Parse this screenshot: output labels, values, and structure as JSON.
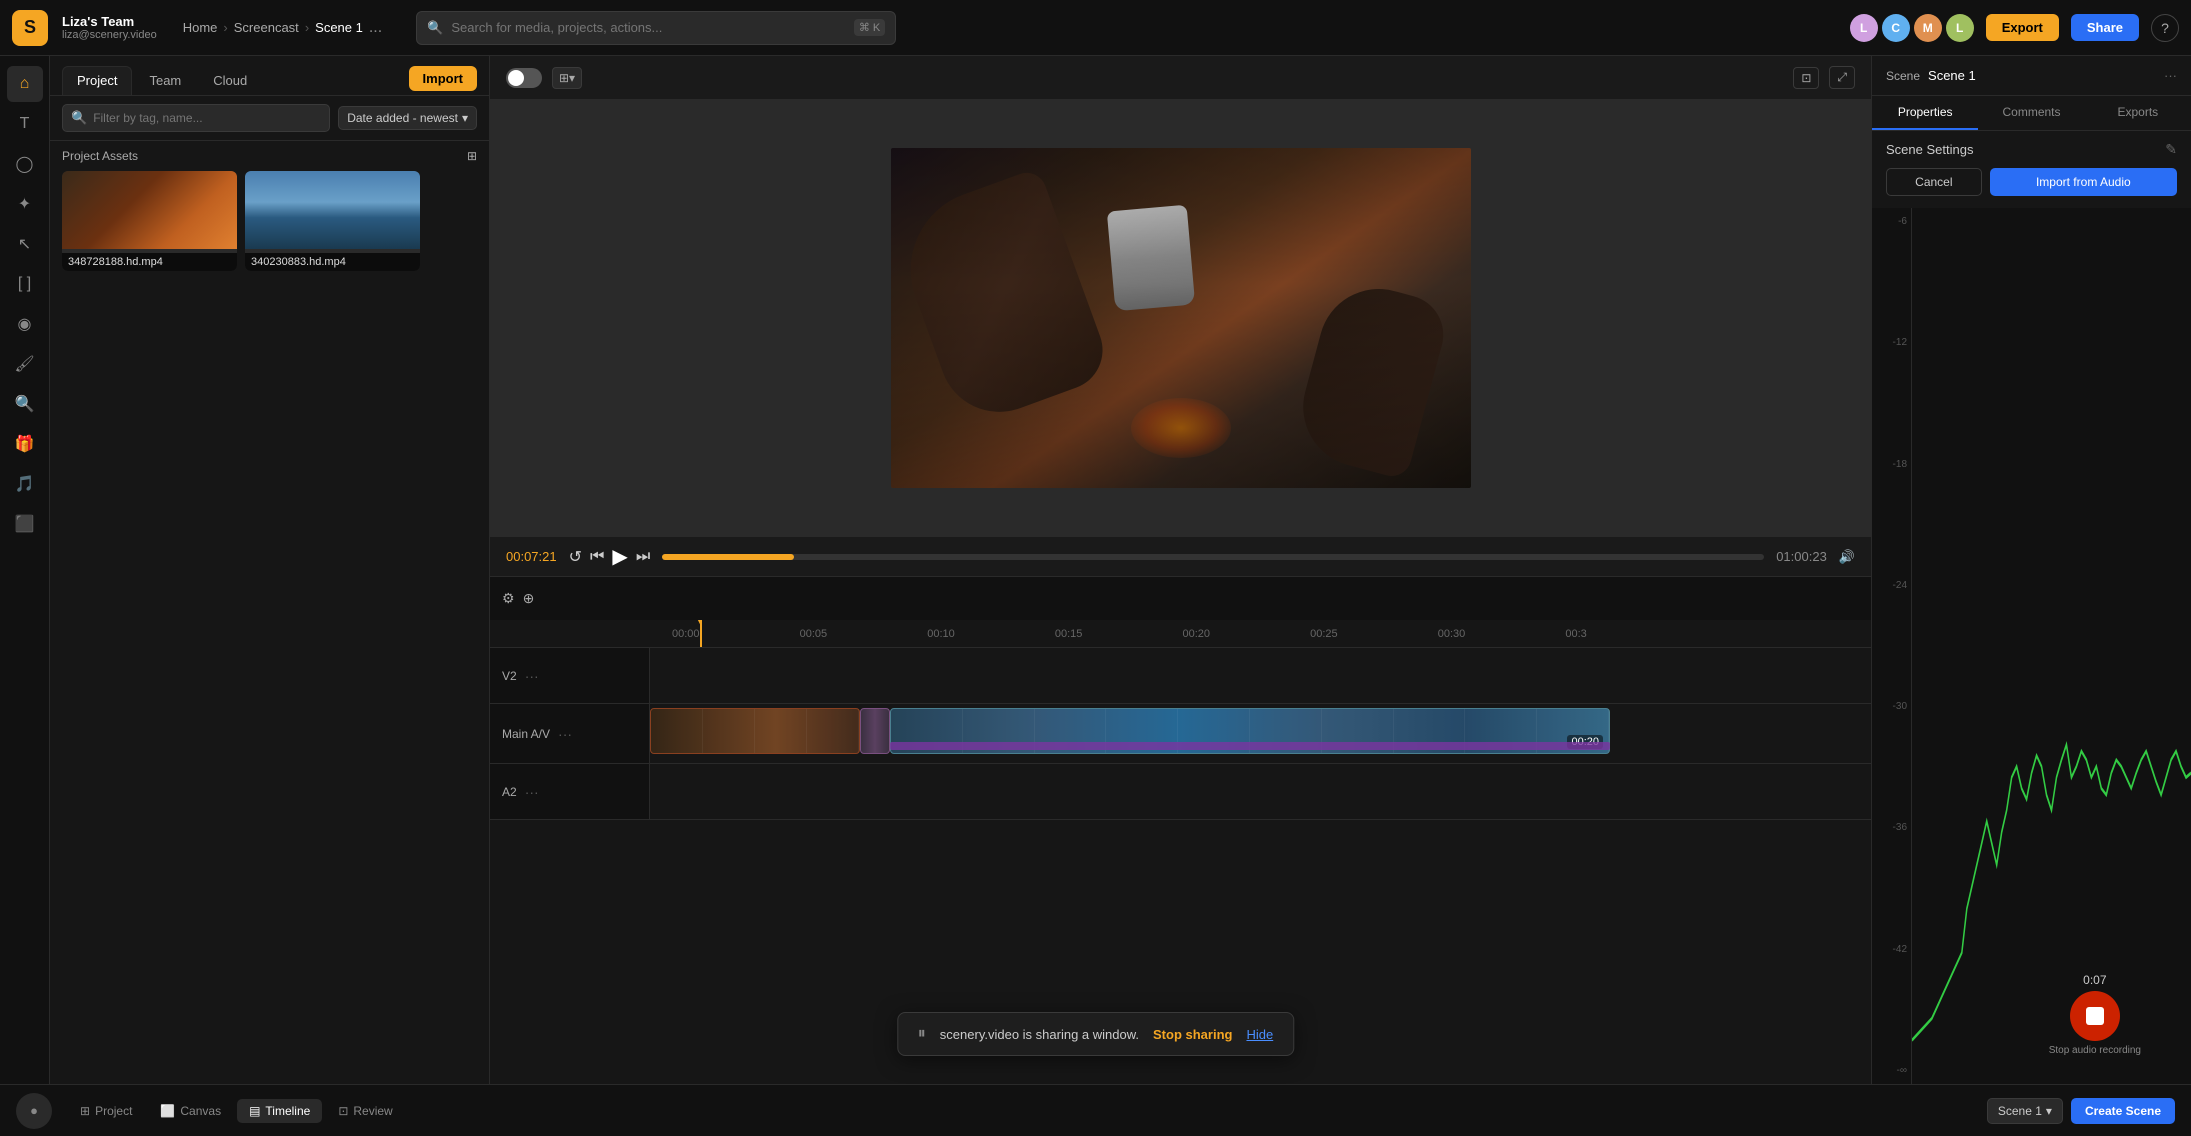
{
  "app": {
    "logo": "S",
    "team_name": "Liza's Team",
    "team_email": "liza@scenery.video",
    "breadcrumb": [
      "Home",
      "Screencast",
      "Scene 1"
    ],
    "more_label": "...",
    "search_placeholder": "Search for media, projects, actions...",
    "search_shortcut_cmd": "⌘",
    "search_shortcut_key": "K"
  },
  "topbar": {
    "export_label": "Export",
    "share_label": "Share",
    "users": [
      "L",
      "C",
      "M",
      "L"
    ],
    "user_colors": [
      "#d0a0e0",
      "#60b0f0",
      "#e09050",
      "#a0c060"
    ]
  },
  "panel_left": {
    "tabs": [
      "Project",
      "Team",
      "Cloud"
    ],
    "active_tab": "Project",
    "import_label": "Import",
    "search_placeholder": "Filter by tag, name...",
    "sort_label": "Date added - newest",
    "assets_header": "Project Assets",
    "assets": [
      {
        "filename": "348728188.hd.mp4",
        "type": "fire"
      },
      {
        "filename": "340230883.hd.mp4",
        "type": "lake"
      }
    ]
  },
  "video": {
    "time_current": "00:07:21",
    "time_total": "01:00:23"
  },
  "timeline": {
    "markers": [
      "00:00",
      "00:05",
      "00:10",
      "00:15",
      "00:20",
      "00:25",
      "00:30",
      "00:3"
    ],
    "tracks": [
      {
        "label": "V2",
        "type": "video"
      },
      {
        "label": "Main A/V",
        "type": "main"
      },
      {
        "label": "A2",
        "type": "audio"
      }
    ],
    "clip_label": "00:20"
  },
  "panel_right": {
    "scene_label": "Scene",
    "scene_name": "Scene 1",
    "tabs": [
      "Properties",
      "Comments",
      "Exports"
    ],
    "active_tab": "Properties",
    "section_title": "Scene Settings",
    "cancel_label": "Cancel",
    "import_label": "Import from Audio",
    "waveform_scale": [
      "-6",
      "-12",
      "-18",
      "-24",
      "-30",
      "-36",
      "-42",
      "-∞"
    ]
  },
  "bottom_bar": {
    "tabs": [
      {
        "label": "Project",
        "icon": "grid"
      },
      {
        "label": "Canvas",
        "icon": "canvas"
      },
      {
        "label": "Timeline",
        "icon": "film",
        "active": true
      },
      {
        "label": "Review",
        "icon": "review"
      }
    ],
    "scene_select_label": "Scene 1",
    "create_scene_label": "Create Scene"
  },
  "sharing_toast": {
    "text": "scenery.video is sharing a window.",
    "stop_label": "Stop sharing",
    "hide_label": "Hide"
  },
  "stop_recording": {
    "time_label": "0:07",
    "tooltip": "Stop audio recording"
  }
}
